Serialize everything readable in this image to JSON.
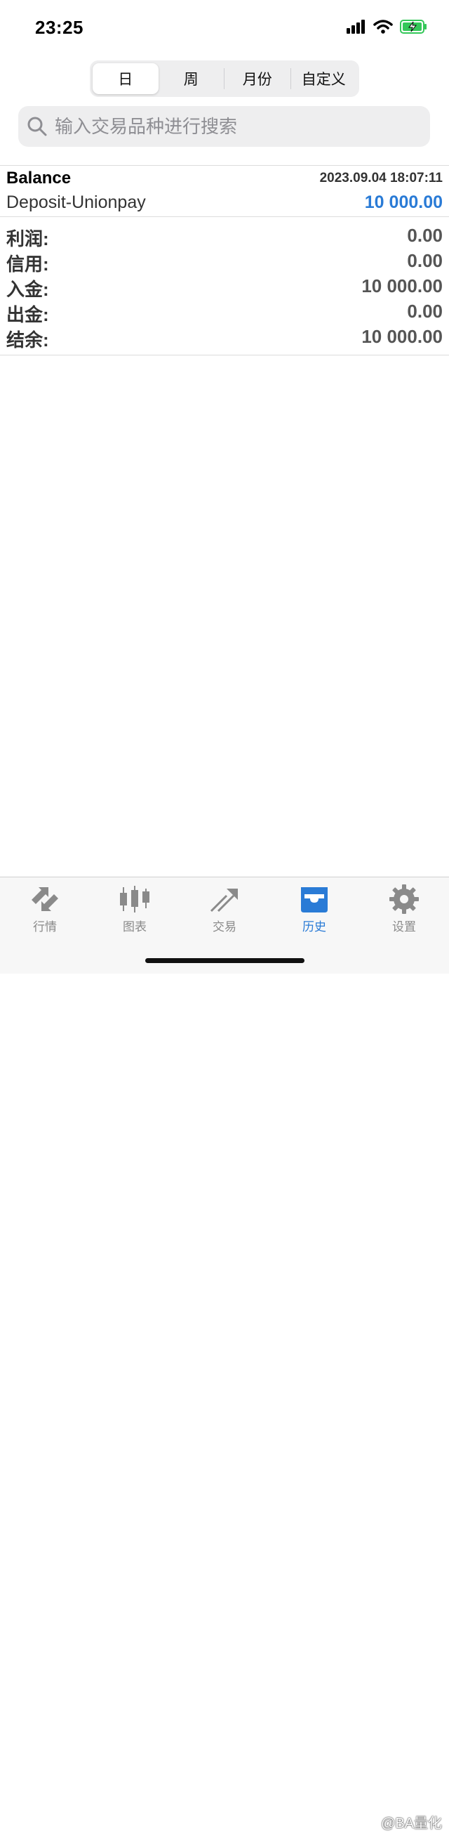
{
  "status_bar": {
    "time": "23:25"
  },
  "segments": [
    {
      "label": "日",
      "active": true
    },
    {
      "label": "周",
      "active": false
    },
    {
      "label": "月份",
      "active": false
    },
    {
      "label": "自定义",
      "active": false
    }
  ],
  "search": {
    "placeholder": "输入交易品种进行搜索",
    "value": ""
  },
  "record": {
    "title": "Balance",
    "datetime": "2023.09.04 18:07:11",
    "description": "Deposit-Unionpay",
    "amount": "10 000.00"
  },
  "summary": [
    {
      "label": "利润:",
      "value": "0.00"
    },
    {
      "label": "信用:",
      "value": "0.00"
    },
    {
      "label": "入金:",
      "value": "10 000.00"
    },
    {
      "label": "出金:",
      "value": "0.00"
    },
    {
      "label": "结余:",
      "value": "10 000.00"
    }
  ],
  "tabbar": [
    {
      "label": "行情",
      "icon": "quotes-icon",
      "active": false
    },
    {
      "label": "图表",
      "icon": "chart-icon",
      "active": false
    },
    {
      "label": "交易",
      "icon": "trade-icon",
      "active": false
    },
    {
      "label": "历史",
      "icon": "history-icon",
      "active": true
    },
    {
      "label": "设置",
      "icon": "gear-icon",
      "active": false
    }
  ],
  "watermark": "@BA量化",
  "colors": {
    "accent": "#2a7bd6",
    "inactive": "#8a8a8a"
  }
}
